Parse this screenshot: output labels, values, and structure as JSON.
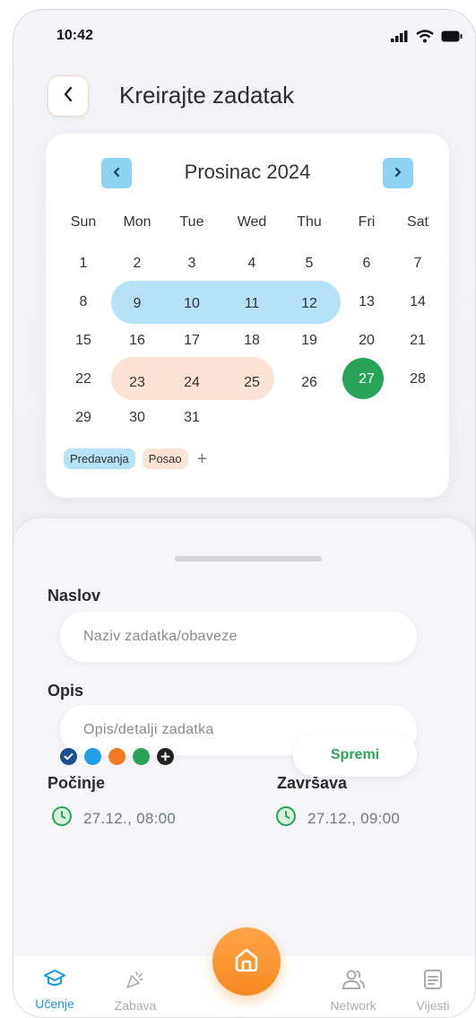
{
  "status_bar": {
    "time": "10:42"
  },
  "header": {
    "title": "Kreirajte zadatak"
  },
  "calendar": {
    "month_title": "Prosinac 2024",
    "weekdays": [
      "Sun",
      "Mon",
      "Tue",
      "Wed",
      "Thu",
      "Fri",
      "Sat"
    ],
    "days": [
      "1",
      "2",
      "3",
      "4",
      "5",
      "6",
      "7",
      "8",
      "9",
      "10",
      "11",
      "12",
      "13",
      "14",
      "15",
      "16",
      "17",
      "18",
      "19",
      "20",
      "21",
      "22",
      "23",
      "24",
      "25",
      "26",
      "27",
      "28",
      "29",
      "30",
      "31"
    ],
    "selected_day": "27",
    "highlights": [
      {
        "label": "Predavanja",
        "days": [
          "9",
          "10",
          "11",
          "12"
        ],
        "color": "#b6e2f7"
      },
      {
        "label": "Posao",
        "days": [
          "23",
          "24",
          "25"
        ],
        "color": "#fbe4d6"
      }
    ],
    "tags": [
      "Predavanja",
      "Posao"
    ],
    "add_tag": "+"
  },
  "form": {
    "title_label": "Naslov",
    "title_placeholder": "Naziv zadatka/obaveze",
    "desc_label": "Opis",
    "desc_placeholder": "Opis/detalji zadatka",
    "start_label": "Počinje",
    "start_value": "27.12., 08:00",
    "end_label": "Završava",
    "end_value": "27.12., 09:00",
    "colors": [
      "#1d4f8a",
      "#1fa0e6",
      "#f57b23",
      "#2aa35a"
    ],
    "save_label": "Spremi"
  },
  "nav": {
    "items": [
      {
        "label": "Učenje",
        "icon": "graduation-cap-icon",
        "active": true
      },
      {
        "label": "Zabava",
        "icon": "party-popper-icon",
        "active": false
      },
      {
        "label": "",
        "icon": "home-icon",
        "active": false
      },
      {
        "label": "Network",
        "icon": "users-icon",
        "active": false
      },
      {
        "label": "Vijesti",
        "icon": "news-icon",
        "active": false
      }
    ]
  },
  "theme": {
    "accent_blue": "#1b9ae0",
    "accent_green": "#2aa35a",
    "accent_orange": "#f68a21"
  }
}
